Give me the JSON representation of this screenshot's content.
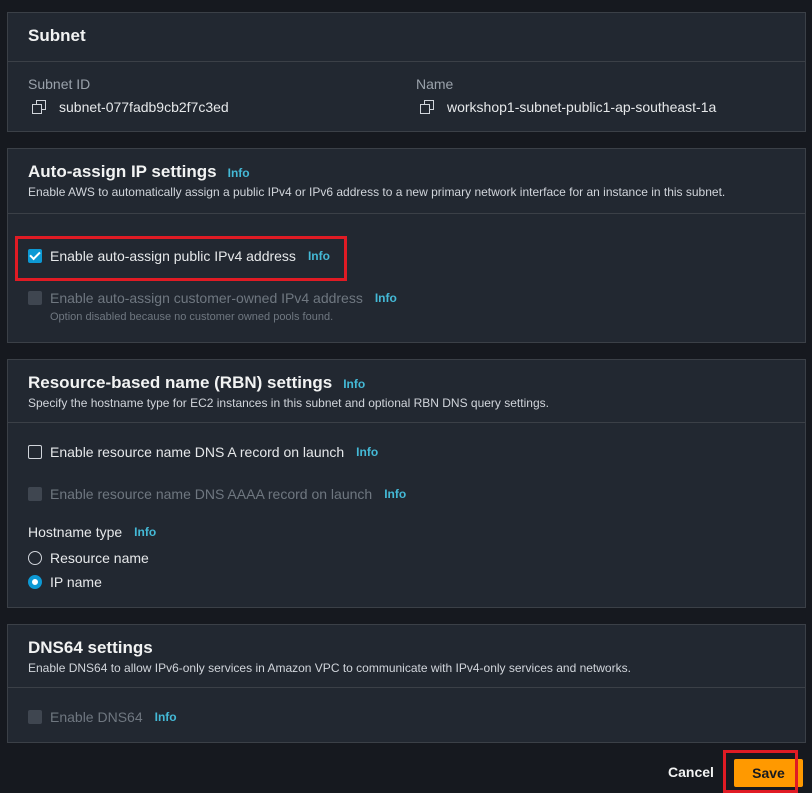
{
  "subnet": {
    "title": "Subnet",
    "id_label": "Subnet ID",
    "id_value": "subnet-077fadb9cb2f7c3ed",
    "name_label": "Name",
    "name_value": "workshop1-subnet-public1-ap-southeast-1a"
  },
  "auto_assign": {
    "title": "Auto-assign IP settings",
    "info": "Info",
    "description": "Enable AWS to automatically assign a public IPv4 or IPv6 address to a new primary network interface for an instance in this subnet.",
    "ipv4_label": "Enable auto-assign public IPv4 address",
    "ipv4_info": "Info",
    "ipv4_checked": true,
    "customer_label": "Enable auto-assign customer-owned IPv4 address",
    "customer_info": "Info",
    "customer_note": "Option disabled because no customer owned pools found."
  },
  "rbn": {
    "title": "Resource-based name (RBN) settings",
    "info": "Info",
    "description": "Specify the hostname type for EC2 instances in this subnet and optional RBN DNS query settings.",
    "dns_a_label": "Enable resource name DNS A record on launch",
    "dns_a_info": "Info",
    "dns_aaaa_label": "Enable resource name DNS AAAA record on launch",
    "dns_aaaa_info": "Info",
    "hostname_label": "Hostname type",
    "hostname_info": "Info",
    "options": [
      "Resource name",
      "IP name"
    ],
    "selected": "IP name"
  },
  "dns64": {
    "title": "DNS64 settings",
    "description": "Enable DNS64 to allow IPv6-only services in Amazon VPC to communicate with IPv4-only services and networks.",
    "label": "Enable DNS64",
    "info": "Info"
  },
  "actions": {
    "cancel": "Cancel",
    "save": "Save"
  },
  "colors": {
    "accent": "#0d99d4",
    "save": "#ff9900",
    "highlight": "#e01b24",
    "link": "#44b9d6"
  }
}
